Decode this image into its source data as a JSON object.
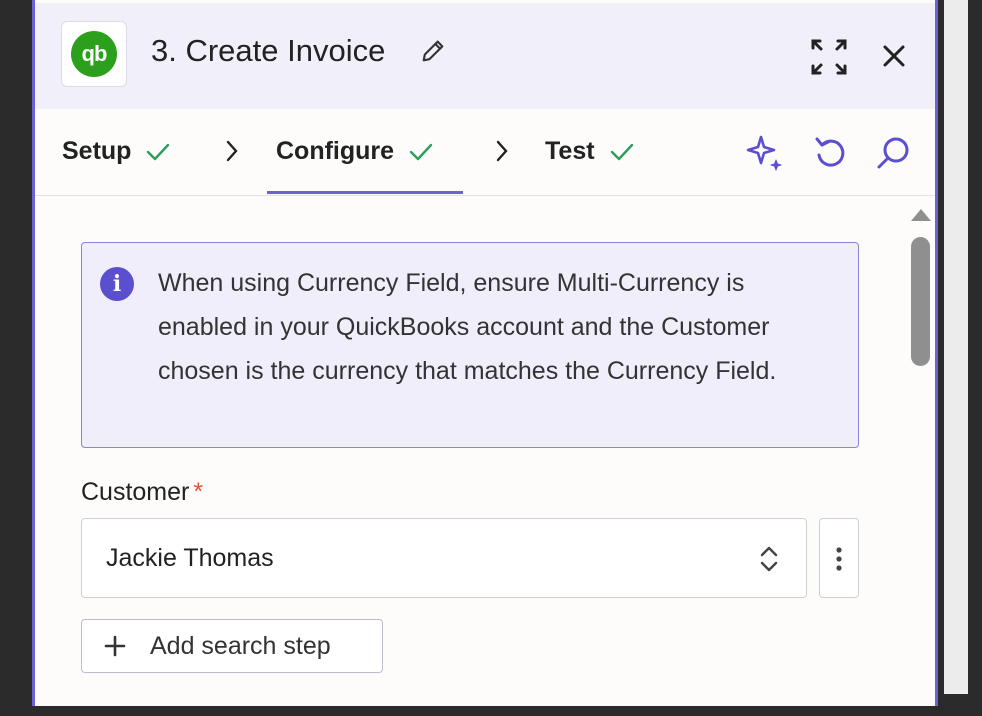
{
  "header": {
    "title": "3. Create Invoice",
    "app_icon": "quickbooks-logo",
    "logo_text": "qb",
    "brand_color": "#2ca01c"
  },
  "tabs": [
    {
      "label": "Setup",
      "status": "complete"
    },
    {
      "label": "Configure",
      "status": "complete",
      "active": true
    },
    {
      "label": "Test",
      "status": "complete"
    }
  ],
  "toolbar": {
    "icons": [
      "sparkle-ai-icon",
      "undo-icon",
      "search-icon"
    ]
  },
  "info_banner": {
    "icon": "info-icon",
    "icon_text": "i",
    "text": "When using Currency Field, ensure Multi-Currency is enabled in your QuickBooks account and the Customer chosen is the currency that matches the Currency Field."
  },
  "customer_field": {
    "label": "Customer",
    "required_mark": "*",
    "value": "Jackie Thomas"
  },
  "add_search_step": {
    "label": "Add search step"
  },
  "colors": {
    "accent": "#6c63d2",
    "check": "#2e9e5b",
    "required": "#e0533a"
  }
}
